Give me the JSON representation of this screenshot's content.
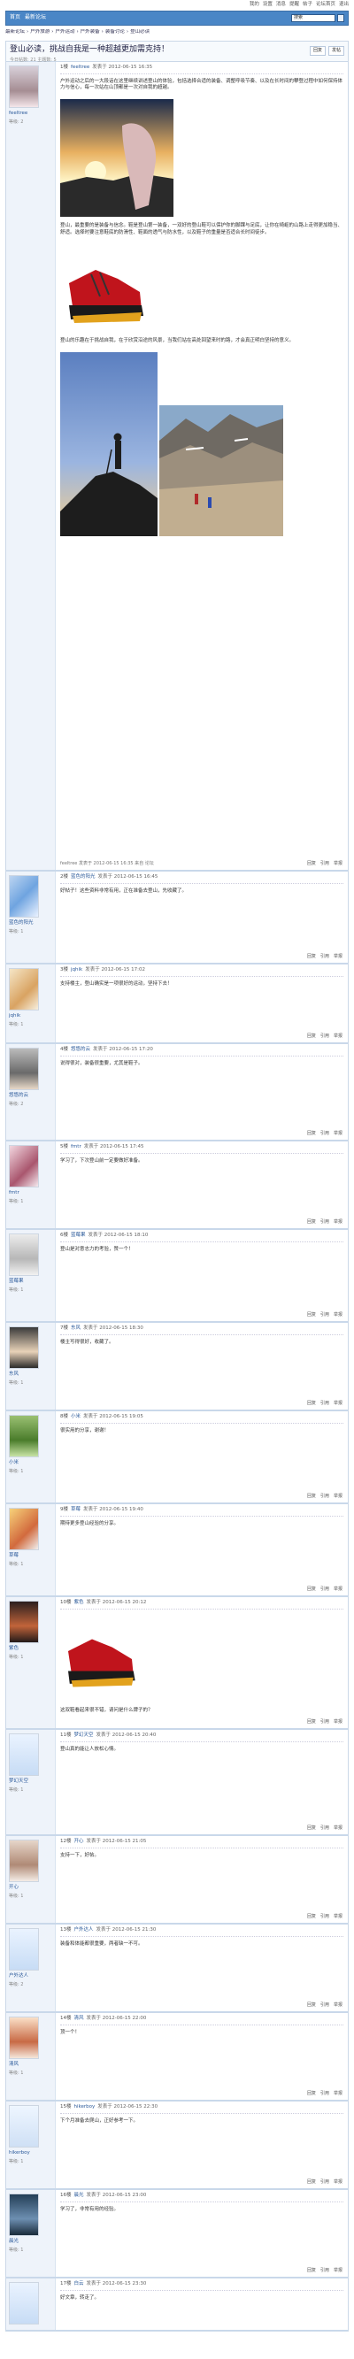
{
  "topbar": {
    "items": [
      "我的",
      "设置",
      "消息",
      "提醒",
      "帖子",
      "论坛首页",
      "退出"
    ]
  },
  "nav": {
    "items": [
      "首页",
      "最新论坛"
    ],
    "search_placeholder": "搜索"
  },
  "breadcrumb": [
    "最新论坛",
    "户外旅游",
    "户外运动",
    "户外装备",
    "装备讨论",
    "登山必读"
  ],
  "thread": {
    "title": "登山必读，挑战自我是一种超越更加需克持！",
    "sub": "今日帖数: 21  主题数: 5",
    "buttons": [
      "回复",
      "发帖"
    ]
  },
  "posts": [
    {
      "floor": "1楼",
      "user": "feeltree",
      "time": "发表于 2012-06-15 16:35",
      "level": "等级: 2",
      "paras": [
        "户外运动之后的一大段话在这里继续讲述登山的体验，包括选择合适的装备、调整呼吸节奏、以及在长时间的攀登过程中如何保持体力与信心，每一次站在山顶都是一次对自我的超越。",
        "登山，最重要的是装备与信念。鞋是登山第一装备，一双好的登山鞋可以保护你的脚踝与足底，让你在崎岖的山路上走得更加稳当、舒适。选择时要注意鞋底的防滑性、鞋面的透气与防水性，以及鞋子的重量是否适合长时间徒步。",
        "登山的乐趣在于挑战自我，在于欣赏沿途的风景，当我们站在高处回望来时的路，才会真正明白坚持的意义。"
      ],
      "sign": "feeltree 发表于 2012-06-15 16:35 来自 论坛"
    },
    {
      "floor": "2楼",
      "user": "蓝色的阳光",
      "time": "发表于 2012-06-15 16:45",
      "level": "等级: 1",
      "text": "好帖子！这些资料非常有用，正在准备去登山，先收藏了。"
    },
    {
      "floor": "3楼",
      "user": "jqhik",
      "time": "发表于 2012-06-15 17:02",
      "level": "等级: 1",
      "text": "支持楼主，登山确实是一项很好的运动，坚持下去！"
    },
    {
      "floor": "4楼",
      "user": "悠悠的云",
      "time": "发表于 2012-06-15 17:20",
      "level": "等级: 2",
      "text": "说得很对，装备很重要，尤其是鞋子。"
    },
    {
      "floor": "5楼",
      "user": "fmtr",
      "time": "发表于 2012-06-15 17:45",
      "level": "等级: 1",
      "text": "学习了，下次登山前一定要做好准备。"
    },
    {
      "floor": "6楼",
      "user": "蓝莓果",
      "time": "发表于 2012-06-15 18:10",
      "level": "等级: 1",
      "text": "登山是对意志力的考验，赞一个！"
    },
    {
      "floor": "7楼",
      "user": "东风",
      "time": "发表于 2012-06-15 18:30",
      "level": "等级: 1",
      "text": "楼主写得很好，收藏了。"
    },
    {
      "floor": "8楼",
      "user": "小米",
      "time": "发表于 2012-06-15 19:05",
      "level": "等级: 1",
      "text": "很实用的分享，谢谢！"
    },
    {
      "floor": "9楼",
      "user": "草莓",
      "time": "发表于 2012-06-15 19:40",
      "level": "等级: 1",
      "text": "期待更多登山经验的分享。"
    },
    {
      "floor": "10楼",
      "user": "紫色",
      "time": "发表于 2012-06-15 20:12",
      "level": "等级: 1",
      "text": "这双鞋看起来很不错，请问是什么牌子的？"
    },
    {
      "floor": "11楼",
      "user": "梦幻天空",
      "time": "发表于 2012-06-15 20:40",
      "level": "等级: 1",
      "text": "登山真的能让人放松心情。"
    },
    {
      "floor": "12楼",
      "user": "开心",
      "time": "发表于 2012-06-15 21:05",
      "level": "等级: 1",
      "text": "支持一下，好帖。"
    },
    {
      "floor": "13楼",
      "user": "户外达人",
      "time": "发表于 2012-06-15 21:30",
      "level": "等级: 2",
      "text": "装备和体能都很重要，两者缺一不可。"
    },
    {
      "floor": "14楼",
      "user": "清风",
      "time": "发表于 2012-06-15 22:00",
      "level": "等级: 1",
      "text": "顶一个！"
    },
    {
      "floor": "15楼",
      "user": "hikerboy",
      "time": "发表于 2012-06-15 22:30",
      "level": "等级: 1",
      "text": "下个月准备去爬山，正好参考一下。"
    },
    {
      "floor": "16楼",
      "user": "晨光",
      "time": "发表于 2012-06-15 23:00",
      "level": "等级: 1",
      "text": "学习了，非常有用的经验。"
    },
    {
      "floor": "17楼",
      "user": "白云",
      "time": "发表于 2012-06-15 23:30",
      "level": "等级: 1",
      "text": "好文章，转走了。"
    }
  ],
  "post_actions": [
    "回复",
    "引用",
    "举报"
  ]
}
